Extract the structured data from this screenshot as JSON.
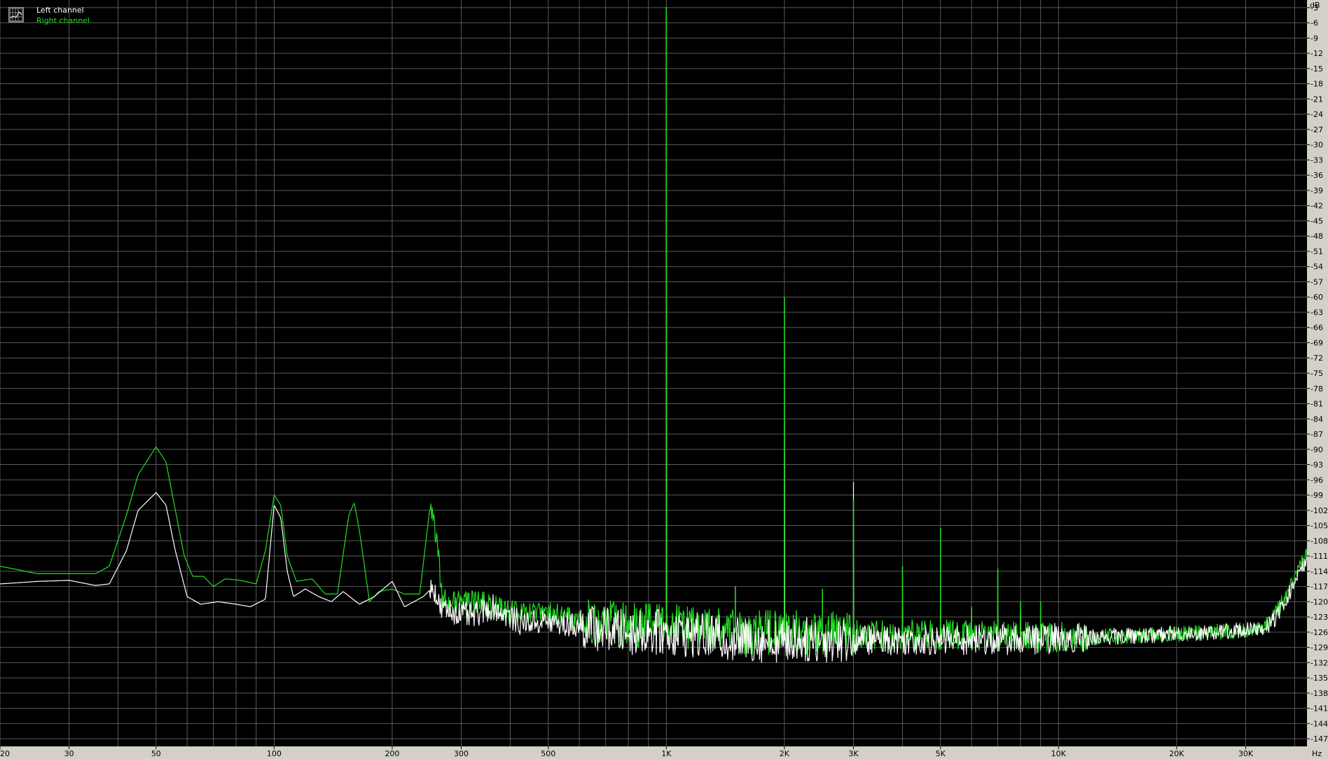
{
  "legend": {
    "left_label": "Left channel",
    "right_label": "Right channel"
  },
  "colors": {
    "background": "#000000",
    "grid": "#5a5a5a",
    "left_channel": "#ffffff",
    "right_channel": "#22dd22",
    "axis_panel": "#d4d0c8",
    "axis_text": "#000000"
  },
  "chart_data": {
    "type": "line",
    "xscale": "log",
    "xlabel": "Hz",
    "ylabel": "dB",
    "xlim": [
      20,
      43000
    ],
    "ylim": [
      -148.5,
      -1.5
    ],
    "grid": true,
    "legend_position": "top-left",
    "x_ticks": [
      {
        "v": 20,
        "label": "20"
      },
      {
        "v": 30,
        "label": "30"
      },
      {
        "v": 50,
        "label": "50"
      },
      {
        "v": 100,
        "label": "100"
      },
      {
        "v": 200,
        "label": "200"
      },
      {
        "v": 300,
        "label": "300"
      },
      {
        "v": 500,
        "label": "500"
      },
      {
        "v": 1000,
        "label": "1K"
      },
      {
        "v": 2000,
        "label": "2K"
      },
      {
        "v": 3000,
        "label": "3K"
      },
      {
        "v": 5000,
        "label": "5K"
      },
      {
        "v": 10000,
        "label": "10K"
      },
      {
        "v": 20000,
        "label": "20K"
      },
      {
        "v": 30000,
        "label": "30K"
      }
    ],
    "x_minor_grid": [
      40,
      60,
      70,
      80,
      90,
      400,
      600,
      700,
      800,
      900,
      4000,
      6000,
      7000,
      8000,
      9000,
      40000
    ],
    "y_ticks": [
      -3,
      -6,
      -9,
      -12,
      -15,
      -18,
      -21,
      -24,
      -27,
      -30,
      -33,
      -36,
      -39,
      -42,
      -45,
      -48,
      -51,
      -54,
      -57,
      -60,
      -63,
      -66,
      -69,
      -72,
      -75,
      -78,
      -81,
      -84,
      -87,
      -90,
      -93,
      -96,
      -99,
      -102,
      -105,
      -108,
      -111,
      -114,
      -117,
      -120,
      -123,
      -126,
      -129,
      -132,
      -135,
      -138,
      -141,
      -144,
      -147
    ],
    "series": [
      {
        "name": "Left channel",
        "color": "#ffffff",
        "points": [
          [
            20,
            -116.5
          ],
          [
            25,
            -116
          ],
          [
            30,
            -115.8
          ],
          [
            35,
            -116.8
          ],
          [
            38,
            -116.5
          ],
          [
            42,
            -110
          ],
          [
            45,
            -102
          ],
          [
            50,
            -98.5
          ],
          [
            53,
            -101
          ],
          [
            56,
            -110
          ],
          [
            60,
            -119
          ],
          [
            65,
            -120.5
          ],
          [
            72,
            -120
          ],
          [
            80,
            -120.5
          ],
          [
            87,
            -121
          ],
          [
            95,
            -119.5
          ],
          [
            100,
            -101
          ],
          [
            104,
            -103.5
          ],
          [
            108,
            -114
          ],
          [
            112,
            -119
          ],
          [
            120,
            -117.5
          ],
          [
            130,
            -119
          ],
          [
            140,
            -120
          ],
          [
            150,
            -118
          ],
          [
            165,
            -120.5
          ],
          [
            180,
            -119
          ],
          [
            200,
            -116
          ],
          [
            215,
            -121
          ],
          [
            240,
            -119
          ],
          [
            255,
            -117
          ],
          [
            265,
            -121.5
          ],
          [
            290,
            -122
          ],
          [
            320,
            -123
          ],
          [
            360,
            -121
          ],
          [
            420,
            -124
          ],
          [
            500,
            -124
          ],
          [
            620,
            -125
          ],
          [
            800,
            -126
          ],
          [
            1000,
            -126
          ],
          [
            1500,
            -127.5
          ],
          [
            2000,
            -127.5
          ],
          [
            3000,
            -127.5
          ],
          [
            5000,
            -127.5
          ],
          [
            8000,
            -127.5
          ],
          [
            12000,
            -127
          ],
          [
            18000,
            -126.5
          ],
          [
            25000,
            -126
          ],
          [
            30000,
            -125.5
          ],
          [
            33000,
            -125.8
          ],
          [
            36000,
            -123
          ],
          [
            39000,
            -118
          ],
          [
            41000,
            -114.5
          ],
          [
            42500,
            -112.5
          ]
        ],
        "spikes": [
          [
            1000,
            -3
          ],
          [
            2000,
            -89
          ],
          [
            3000,
            -96.5
          ],
          [
            4000,
            -121
          ],
          [
            5000,
            -121
          ],
          [
            6000,
            -121.5
          ],
          [
            7000,
            -122
          ],
          [
            8000,
            -122.5
          ]
        ]
      },
      {
        "name": "Right channel",
        "color": "#22dd22",
        "points": [
          [
            20,
            -113
          ],
          [
            25,
            -114.5
          ],
          [
            30,
            -114.5
          ],
          [
            35,
            -114.5
          ],
          [
            38,
            -113
          ],
          [
            42,
            -103
          ],
          [
            45,
            -95
          ],
          [
            50,
            -89.5
          ],
          [
            53,
            -92.5
          ],
          [
            56,
            -102
          ],
          [
            59,
            -111
          ],
          [
            62,
            -115
          ],
          [
            66,
            -115
          ],
          [
            70,
            -117
          ],
          [
            75,
            -115.5
          ],
          [
            82,
            -115.8
          ],
          [
            90,
            -116.5
          ],
          [
            95,
            -110
          ],
          [
            100,
            -99
          ],
          [
            104,
            -101
          ],
          [
            108,
            -111
          ],
          [
            114,
            -116
          ],
          [
            125,
            -115.5
          ],
          [
            135,
            -118.5
          ],
          [
            145,
            -118.5
          ],
          [
            155,
            -103
          ],
          [
            160,
            -100.5
          ],
          [
            165,
            -106
          ],
          [
            175,
            -120
          ],
          [
            185,
            -118
          ],
          [
            200,
            -117.5
          ],
          [
            215,
            -118.5
          ],
          [
            235,
            -118.5
          ],
          [
            250,
            -101
          ],
          [
            258,
            -106
          ],
          [
            268,
            -119
          ],
          [
            290,
            -120.5
          ],
          [
            320,
            -120
          ],
          [
            360,
            -121
          ],
          [
            420,
            -122.5
          ],
          [
            500,
            -122.5
          ],
          [
            620,
            -124
          ],
          [
            800,
            -124.5
          ],
          [
            1000,
            -124.5
          ],
          [
            1500,
            -126
          ],
          [
            2000,
            -126
          ],
          [
            3000,
            -126.5
          ],
          [
            5000,
            -126.5
          ],
          [
            8000,
            -127
          ],
          [
            12000,
            -127
          ],
          [
            18000,
            -126.5
          ],
          [
            25000,
            -126
          ],
          [
            30000,
            -125.5
          ],
          [
            33000,
            -125.5
          ],
          [
            36000,
            -122
          ],
          [
            39000,
            -117
          ],
          [
            41000,
            -113.5
          ],
          [
            42500,
            -111
          ]
        ],
        "spikes": [
          [
            1000,
            -3
          ],
          [
            1500,
            -117
          ],
          [
            2000,
            -60
          ],
          [
            2500,
            -117.5
          ],
          [
            3000,
            -100
          ],
          [
            4000,
            -113
          ],
          [
            5000,
            -105.5
          ],
          [
            6000,
            -121
          ],
          [
            7000,
            -113.5
          ],
          [
            8000,
            -120
          ],
          [
            9000,
            -120
          ]
        ]
      }
    ]
  }
}
